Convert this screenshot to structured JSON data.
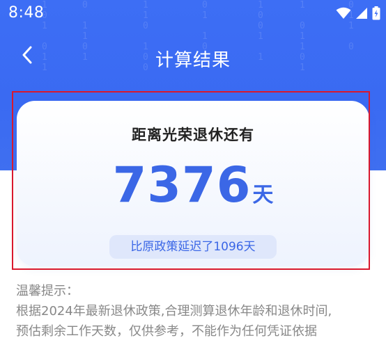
{
  "status_bar": {
    "time": "8:48",
    "icons": [
      "wifi-icon",
      "signal-icon",
      "battery-icon"
    ]
  },
  "nav": {
    "back_icon": "chevron-left-icon",
    "title": "计算结果"
  },
  "result_card": {
    "heading": "距离光荣退休还有",
    "days_value": "7376",
    "days_unit": "天",
    "delay_text": "比原政策延迟了1096天"
  },
  "tips": {
    "title": "温馨提示：",
    "line1": "根据2024年最新退休政策,合理测算退休年龄和退休时间,",
    "line2": "预估剩余工作天数，仅供参考，不能作为任何凭证依据"
  },
  "colors": {
    "primary_blue": "#3b67e6",
    "header_blue": "#3d6ef5",
    "badge_bg": "#dfe7fb",
    "highlight_red": "#d9182d",
    "tip_gray": "#888888"
  }
}
